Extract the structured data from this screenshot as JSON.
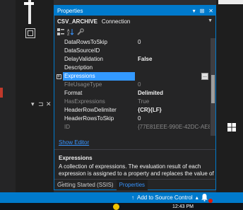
{
  "properties_window": {
    "title": "Properties",
    "title_buttons": [
      "▾",
      "⊞",
      "✕"
    ],
    "object_name": "CSV_ARCHIVE",
    "object_type": "Connection",
    "rows": [
      {
        "name": "DataRowsToSkip",
        "value": "0",
        "bold": false,
        "dim": false,
        "selected": false,
        "expander": false
      },
      {
        "name": "DataSourceID",
        "value": "",
        "bold": false,
        "dim": false,
        "selected": false,
        "expander": false
      },
      {
        "name": "DelayValidation",
        "value": "False",
        "bold": true,
        "dim": false,
        "selected": false,
        "expander": false
      },
      {
        "name": "Description",
        "value": "",
        "bold": false,
        "dim": false,
        "selected": false,
        "expander": false
      },
      {
        "name": "Expressions",
        "value": "",
        "bold": false,
        "dim": false,
        "selected": true,
        "expander": true
      },
      {
        "name": "FileUsageType",
        "value": "0",
        "bold": false,
        "dim": true,
        "selected": false,
        "expander": false
      },
      {
        "name": "Format",
        "value": "Delimited",
        "bold": true,
        "dim": false,
        "selected": false,
        "expander": false
      },
      {
        "name": "HasExpressions",
        "value": "True",
        "bold": false,
        "dim": true,
        "selected": false,
        "expander": false
      },
      {
        "name": "HeaderRowDelimiter",
        "value": "{CR}{LF}",
        "bold": true,
        "dim": false,
        "selected": false,
        "expander": false
      },
      {
        "name": "HeaderRowsToSkip",
        "value": "0",
        "bold": false,
        "dim": false,
        "selected": false,
        "expander": false
      },
      {
        "name": "ID",
        "value": "{77E81EEE-990E-42DC-AE83-9",
        "bold": false,
        "dim": true,
        "selected": false,
        "expander": false
      }
    ],
    "expander_symbol": "+",
    "ellipsis_label": "...",
    "editor_link": "Show Editor",
    "description_title": "Expressions",
    "description_text": "A collection of expressions. The evaluation result of each expression is assigned to a property and replaces the value of ...",
    "tabs": [
      "Getting Started (SSIS)",
      "Properties"
    ],
    "active_tab": 1
  },
  "status_bar": {
    "source_control_label": "Add to Source Control",
    "up_arrow": "↑",
    "dropdown_arrow": "▴",
    "bell": "🔔"
  },
  "taskbar": {
    "clock": "12:43 PM"
  },
  "left_pins": [
    "▾",
    "⊐",
    "✕"
  ],
  "colors": {
    "accent": "#007acc",
    "selection": "#3399ff",
    "link": "#3794ff",
    "badge": "#e51400"
  }
}
